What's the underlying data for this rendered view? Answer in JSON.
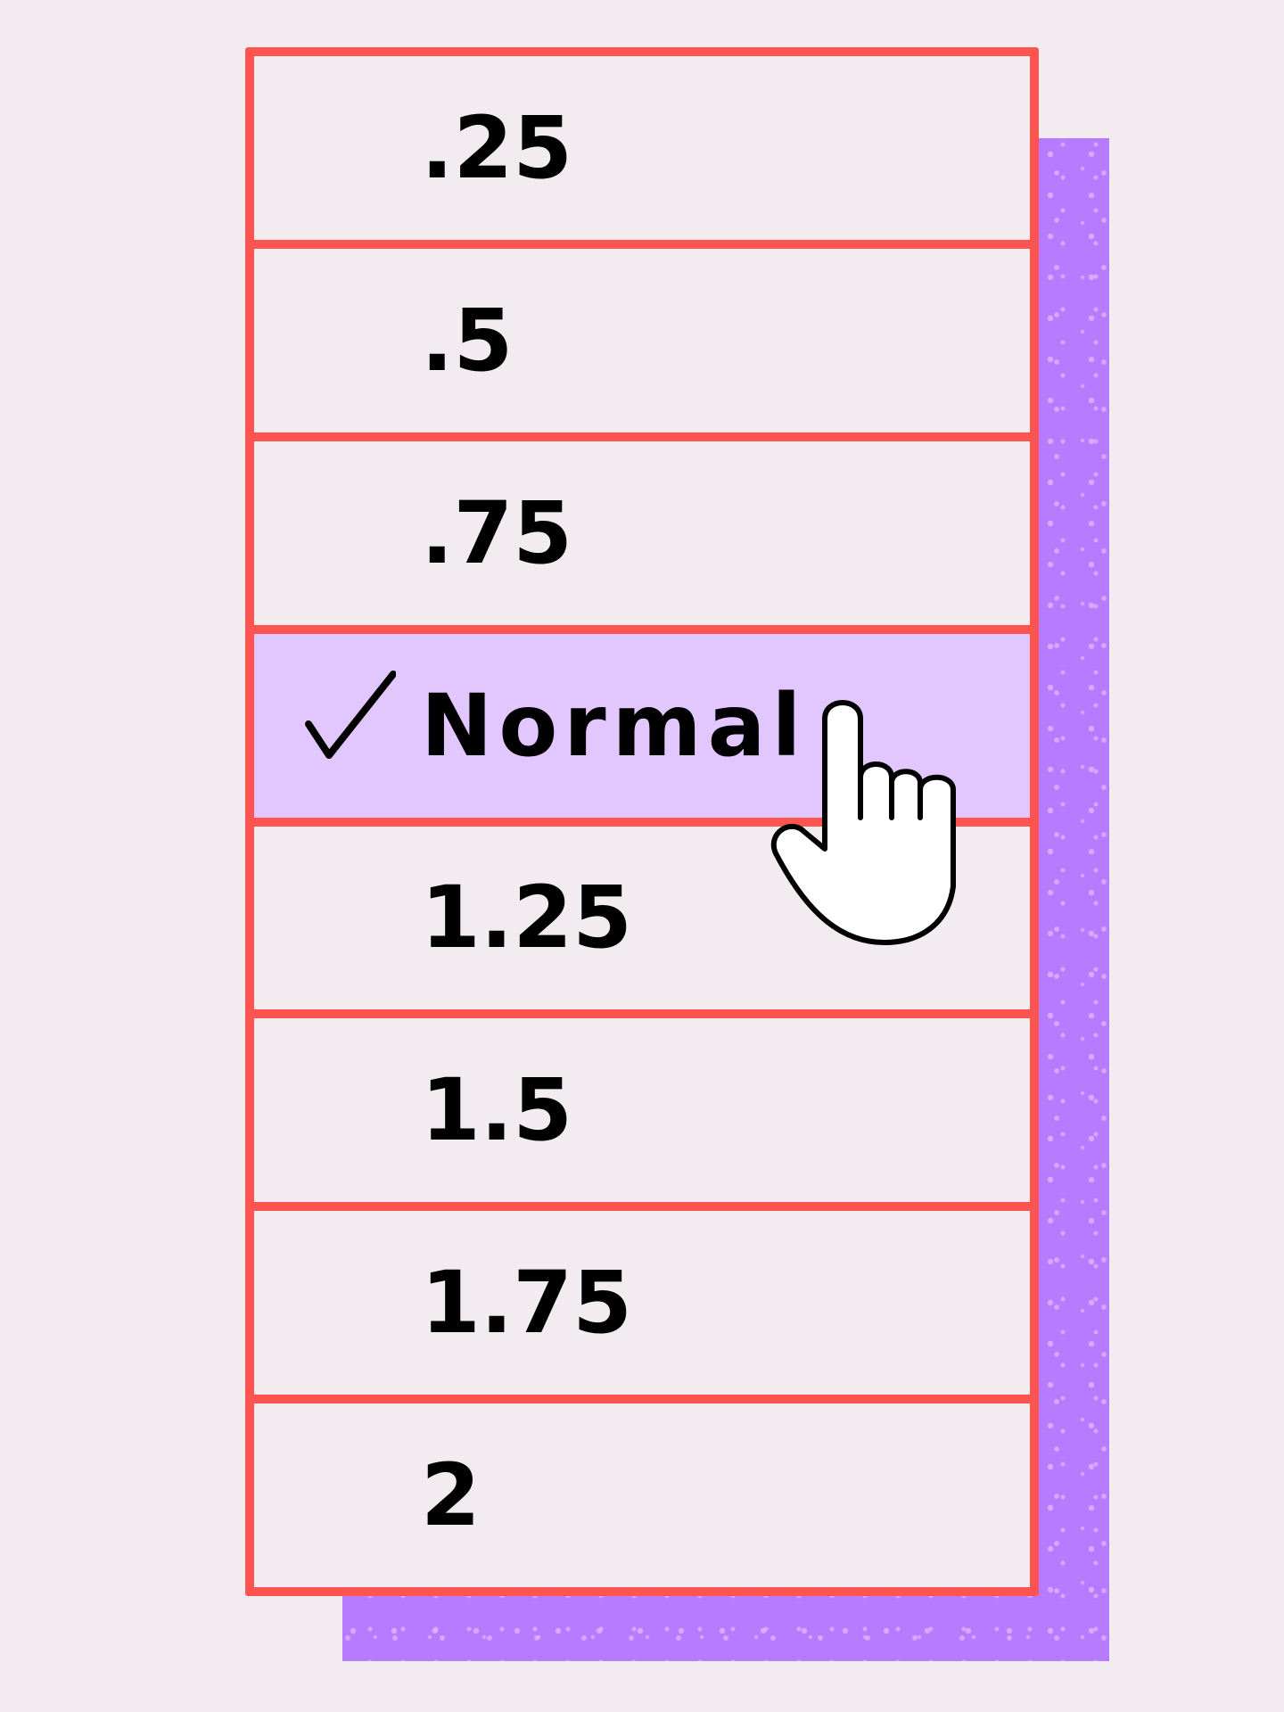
{
  "speed_menu": {
    "items": [
      {
        "label": ".25",
        "selected": false
      },
      {
        "label": ".5",
        "selected": false
      },
      {
        "label": ".75",
        "selected": false
      },
      {
        "label": "Normal",
        "selected": true
      },
      {
        "label": "1.25",
        "selected": false
      },
      {
        "label": "1.5",
        "selected": false
      },
      {
        "label": "1.75",
        "selected": false
      },
      {
        "label": "2",
        "selected": false
      }
    ],
    "selected_label": "Normal"
  },
  "colors": {
    "background": "#f2ebf0",
    "border": "#ff5450",
    "shadow": "#b67bff",
    "shadow_speckle": "#e6b4ff",
    "selected_row": "#e2c6fe",
    "text": "#000000"
  },
  "icons": {
    "selected_marker": "check-icon",
    "cursor": "pointing-hand-icon"
  }
}
